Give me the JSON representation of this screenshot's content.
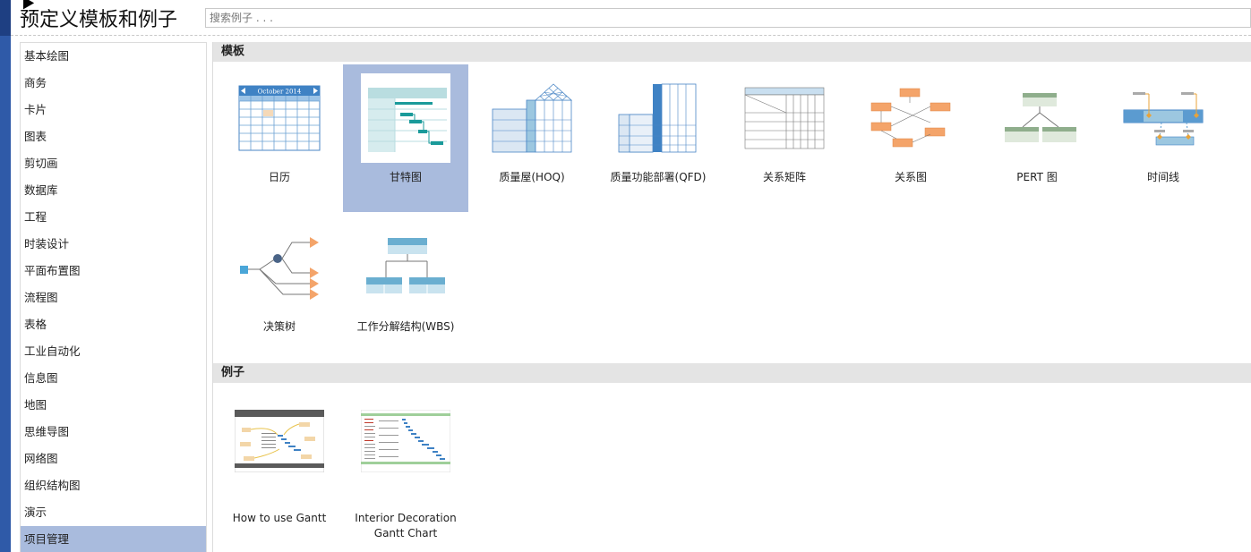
{
  "header": {
    "title": "预定义模板和例子",
    "search_placeholder": "搜索例子 . . ."
  },
  "sidebar": {
    "items": [
      {
        "label": "基本绘图"
      },
      {
        "label": "商务"
      },
      {
        "label": "卡片"
      },
      {
        "label": "图表"
      },
      {
        "label": "剪切画"
      },
      {
        "label": "数据库"
      },
      {
        "label": "工程"
      },
      {
        "label": "时装设计"
      },
      {
        "label": "平面布置图"
      },
      {
        "label": "流程图"
      },
      {
        "label": "表格"
      },
      {
        "label": "工业自动化"
      },
      {
        "label": "信息图"
      },
      {
        "label": "地图"
      },
      {
        "label": "思维导图"
      },
      {
        "label": "网络图"
      },
      {
        "label": "组织结构图"
      },
      {
        "label": "演示"
      },
      {
        "label": "项目管理"
      }
    ],
    "active_index": 18
  },
  "templates": {
    "section_title": "模板",
    "items": [
      {
        "label": "日历",
        "calendar_caption": "October 2014"
      },
      {
        "label": "甘特图"
      },
      {
        "label": "质量屋(HOQ)"
      },
      {
        "label": "质量功能部署(QFD)"
      },
      {
        "label": "关系矩阵"
      },
      {
        "label": "关系图"
      },
      {
        "label": "PERT 图"
      },
      {
        "label": "时间线"
      },
      {
        "label": "决策树"
      },
      {
        "label": "工作分解结构(WBS)"
      }
    ],
    "selected_index": 1
  },
  "examples": {
    "section_title": "例子",
    "items": [
      {
        "label_line1": "How to use Gantt",
        "label_line2": ""
      },
      {
        "label_line1": "Interior Decoration",
        "label_line2": "Gantt Chart"
      }
    ]
  },
  "colors": {
    "accent_selected": "#a9bbdd",
    "section_bg": "#e4e4e4",
    "strip_blue": "#2f5aa8"
  }
}
